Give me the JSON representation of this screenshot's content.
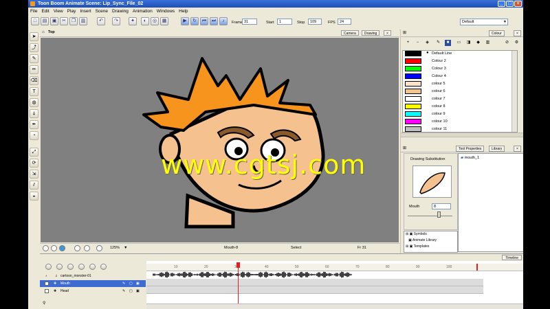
{
  "window": {
    "title": "Toon Boom Animate Scene: Lip_Sync_File_02",
    "controls": {
      "minimize": "_",
      "maximize": "□",
      "close": "×"
    }
  },
  "menu": [
    "File",
    "Edit",
    "View",
    "Play",
    "Insert",
    "Scene",
    "Drawing",
    "Animation",
    "Windows",
    "Help"
  ],
  "toolbar": {
    "frame_label": "Frame",
    "frame_value": "31",
    "start_label": "Start",
    "start_value": "1",
    "stop_label": "Stop",
    "stop_value": "109",
    "fps_label": "FPS",
    "fps_value": "24",
    "workspace_value": "Default"
  },
  "viewport": {
    "header_label": "Top",
    "tabs": [
      "Camera",
      "Drawing"
    ],
    "zoom": "125%",
    "status_drawing": "Mouth-8",
    "status_tool": "Select",
    "status_frame": "Fr 31",
    "watermark": "www.cgtsj.com"
  },
  "colour_panel": {
    "tab": "Colour",
    "colors": [
      {
        "name": "Default Line",
        "hex": "#000000"
      },
      {
        "name": "Colour 2",
        "hex": "#ff0000"
      },
      {
        "name": "Colour 3",
        "hex": "#00ff00"
      },
      {
        "name": "Colour 4",
        "hex": "#0000ff"
      },
      {
        "name": "colour 5",
        "hex": "#ffe2c8"
      },
      {
        "name": "colour 6",
        "hex": "#f0c38f"
      },
      {
        "name": "colour 7",
        "hex": "#ffffff"
      },
      {
        "name": "colour 8",
        "hex": "#ffff00"
      },
      {
        "name": "colour 9",
        "hex": "#00ffff"
      },
      {
        "name": "colour 10",
        "hex": "#ff00ff"
      },
      {
        "name": "colour 11",
        "hex": "#c0c0c0"
      }
    ]
  },
  "tool_panel": {
    "tabs": [
      "Tool Properties",
      "Library"
    ],
    "drawing_substitution": "Drawing Substitution",
    "mouth_label": "Mouth",
    "mouth_value": "8",
    "library_item": "mouth_1",
    "tree": [
      "Symbols",
      "Animate Library",
      "Templates"
    ]
  },
  "timeline": {
    "tab": "Timeline",
    "layers": [
      {
        "name": "cartoon_monster-01",
        "selected": false
      },
      {
        "name": "Mouth",
        "selected": true
      },
      {
        "name": "Head",
        "selected": false
      }
    ],
    "ticks": [
      "10",
      "20",
      "30",
      "40",
      "50",
      "60",
      "70",
      "80",
      "90",
      "100"
    ],
    "current_frame": 31,
    "last_frame": 109
  },
  "accent": {
    "selection": "#3d6bd0",
    "playhead": "#e02020",
    "hair": "#f7941d",
    "skin": "#f5c18f"
  }
}
